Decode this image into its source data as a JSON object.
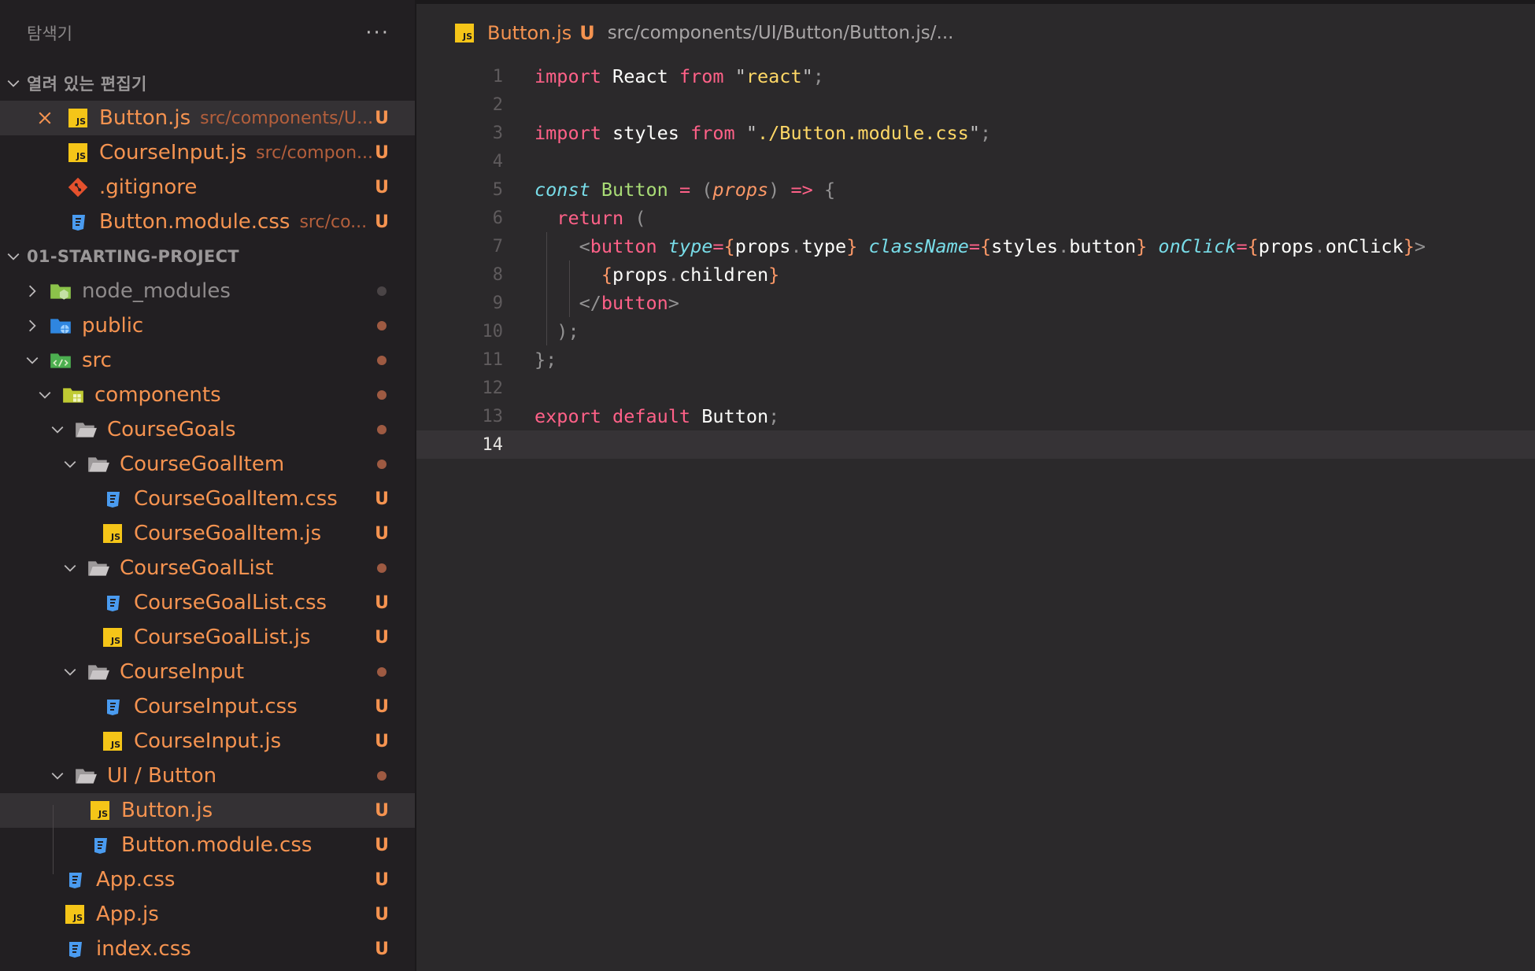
{
  "explorer": {
    "title": "탐색기",
    "more": "···",
    "open_editors_label": "열려 있는 편집기",
    "open_editors": [
      {
        "name": "Button.js",
        "desc": "src/components/U...",
        "status": "U",
        "type": "js",
        "active": true
      },
      {
        "name": "CourseInput.js",
        "desc": "src/compon...",
        "status": "U",
        "type": "js"
      },
      {
        "name": ".gitignore",
        "desc": "",
        "status": "U",
        "type": "git"
      },
      {
        "name": "Button.module.css",
        "desc": "src/co...",
        "status": "U",
        "type": "css"
      }
    ],
    "project_label": "01-STARTING-PROJECT",
    "tree": [
      {
        "name": "node_modules",
        "type": "folder-node"
      },
      {
        "name": "public",
        "type": "folder-public"
      },
      {
        "name": "src",
        "type": "folder-src"
      },
      {
        "name": "components",
        "type": "folder-components"
      },
      {
        "name": "CourseGoals",
        "type": "folder"
      },
      {
        "name": "CourseGoalItem",
        "type": "folder"
      },
      {
        "name": "CourseGoalItem.css",
        "status": "U",
        "type": "css"
      },
      {
        "name": "CourseGoalItem.js",
        "status": "U",
        "type": "js"
      },
      {
        "name": "CourseGoalList",
        "type": "folder"
      },
      {
        "name": "CourseGoalList.css",
        "status": "U",
        "type": "css"
      },
      {
        "name": "CourseGoalList.js",
        "status": "U",
        "type": "js"
      },
      {
        "name": "CourseInput",
        "type": "folder"
      },
      {
        "name": "CourseInput.css",
        "status": "U",
        "type": "css"
      },
      {
        "name": "CourseInput.js",
        "status": "U",
        "type": "js"
      },
      {
        "name": "UI / Button",
        "type": "folder"
      },
      {
        "name": "Button.js",
        "status": "U",
        "type": "js"
      },
      {
        "name": "Button.module.css",
        "status": "U",
        "type": "css"
      },
      {
        "name": "App.css",
        "status": "U",
        "type": "css"
      },
      {
        "name": "App.js",
        "status": "U",
        "type": "js"
      },
      {
        "name": "index.css",
        "status": "U",
        "type": "css"
      }
    ]
  },
  "breadcrumb": {
    "file": "Button.js",
    "status": "U",
    "path": "src/components/UI/Button/Button.js/..."
  },
  "code": {
    "line_numbers": [
      "1",
      "2",
      "3",
      "4",
      "5",
      "6",
      "7",
      "8",
      "9",
      "10",
      "11",
      "12",
      "13",
      "14"
    ],
    "current_line": "14"
  },
  "colors": {
    "accent_orange": "#f59350",
    "js_yellow": "#f5c518",
    "css_blue": "#4a9bf0",
    "git_red": "#e5512d"
  }
}
